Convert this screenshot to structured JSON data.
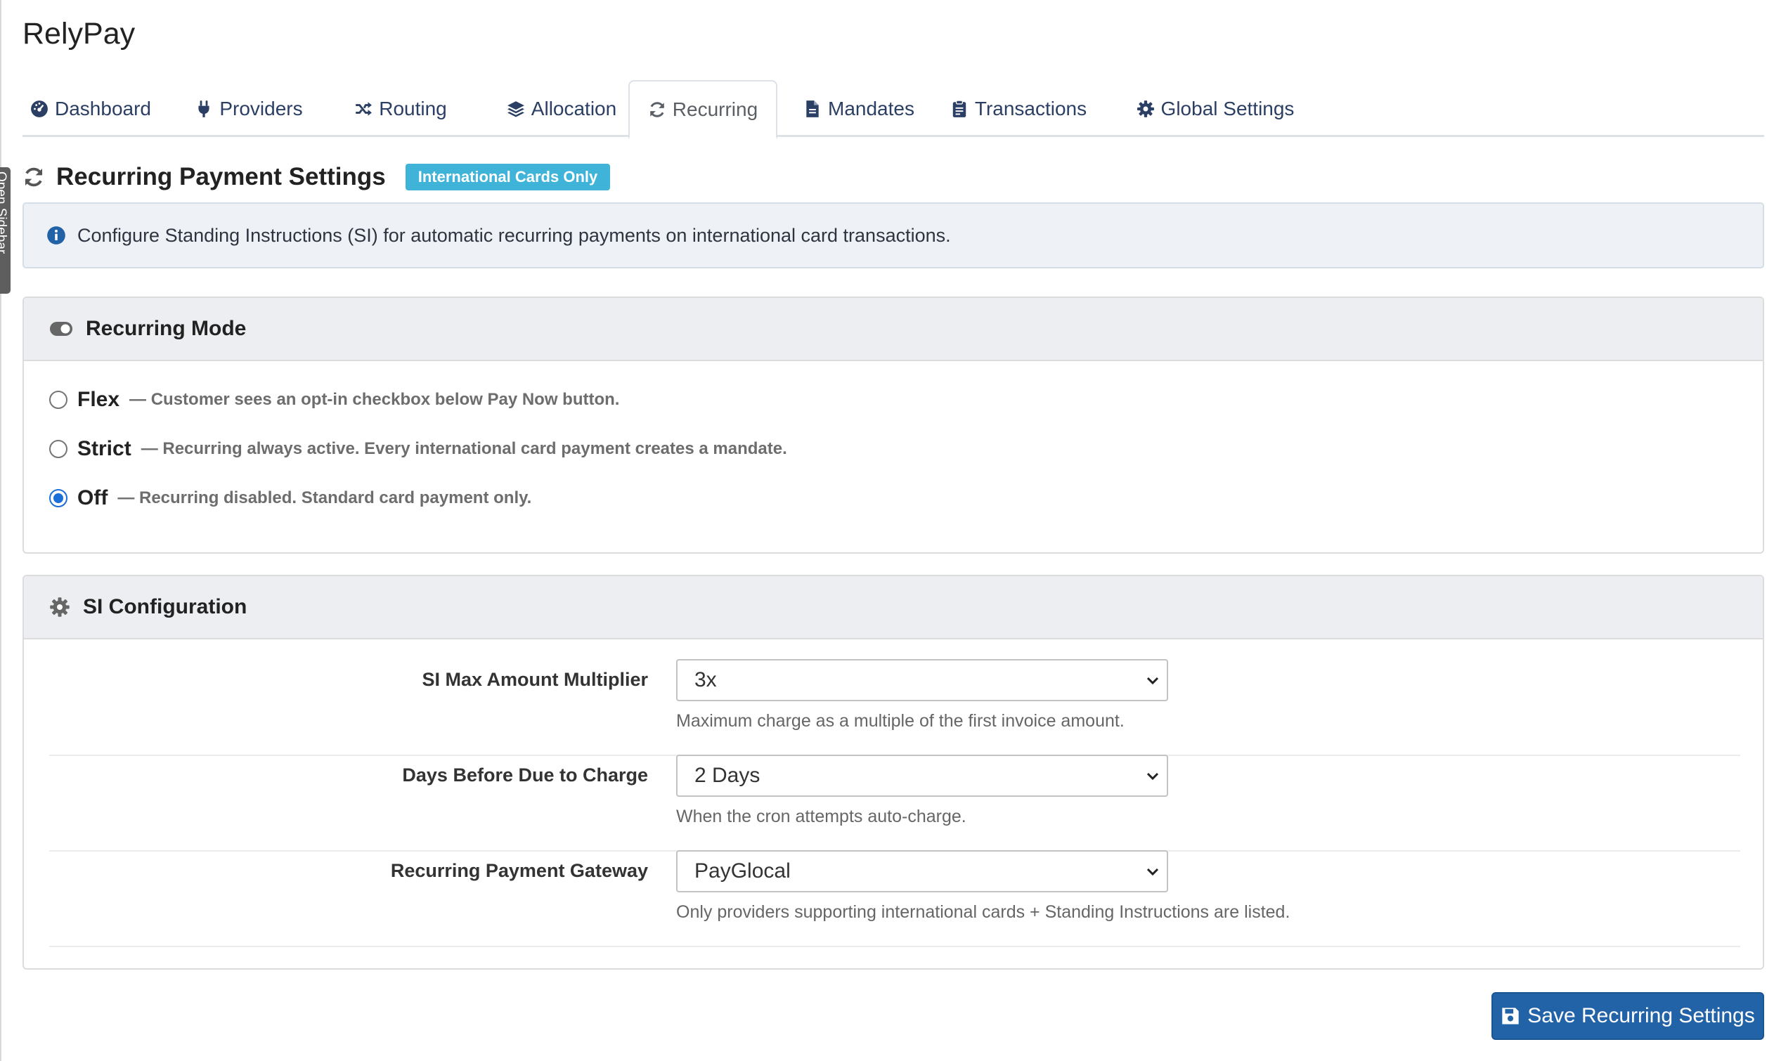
{
  "app": {
    "title": "RelyPay"
  },
  "sidebar_toggle": {
    "label": "Open Sidebar"
  },
  "tabs": [
    {
      "label": "Dashboard",
      "icon": "dashboard-icon"
    },
    {
      "label": "Providers",
      "icon": "plug-icon"
    },
    {
      "label": "Routing",
      "icon": "shuffle-icon"
    },
    {
      "label": "Allocation",
      "icon": "layers-icon"
    },
    {
      "label": "Recurring",
      "icon": "sync-icon",
      "active": true
    },
    {
      "label": "Mandates",
      "icon": "file-icon"
    },
    {
      "label": "Transactions",
      "icon": "clipboard-icon"
    },
    {
      "label": "Global Settings",
      "icon": "gear-icon"
    }
  ],
  "section": {
    "title": "Recurring Payment Settings",
    "badge": "International Cards Only",
    "info": "Configure Standing Instructions (SI) for automatic recurring payments on international card transactions."
  },
  "recurring_mode": {
    "title": "Recurring Mode",
    "selected": "Off",
    "options": [
      {
        "name": "Flex",
        "description": "— Customer sees an opt-in checkbox below Pay Now button."
      },
      {
        "name": "Strict",
        "description": "— Recurring always active. Every international card payment creates a mandate."
      },
      {
        "name": "Off",
        "description": "— Recurring disabled. Standard card payment only."
      }
    ]
  },
  "si_config": {
    "title": "SI Configuration",
    "fields": [
      {
        "label": "SI Max Amount Multiplier",
        "value": "3x",
        "help": "Maximum charge as a multiple of the first invoice amount."
      },
      {
        "label": "Days Before Due to Charge",
        "value": "2 Days",
        "help": "When the cron attempts auto-charge."
      },
      {
        "label": "Recurring Payment Gateway",
        "value": "PayGlocal",
        "help": "Only providers supporting international cards + Standing Instructions are listed."
      }
    ]
  },
  "save_button": {
    "label": "Save Recurring Settings"
  },
  "colors": {
    "nav_text": "#2b3e63",
    "badge": "#3fb4d8",
    "primary_button": "#2263a8",
    "radio_checked": "#1a6fd8",
    "info_bg": "#eef2f7"
  }
}
